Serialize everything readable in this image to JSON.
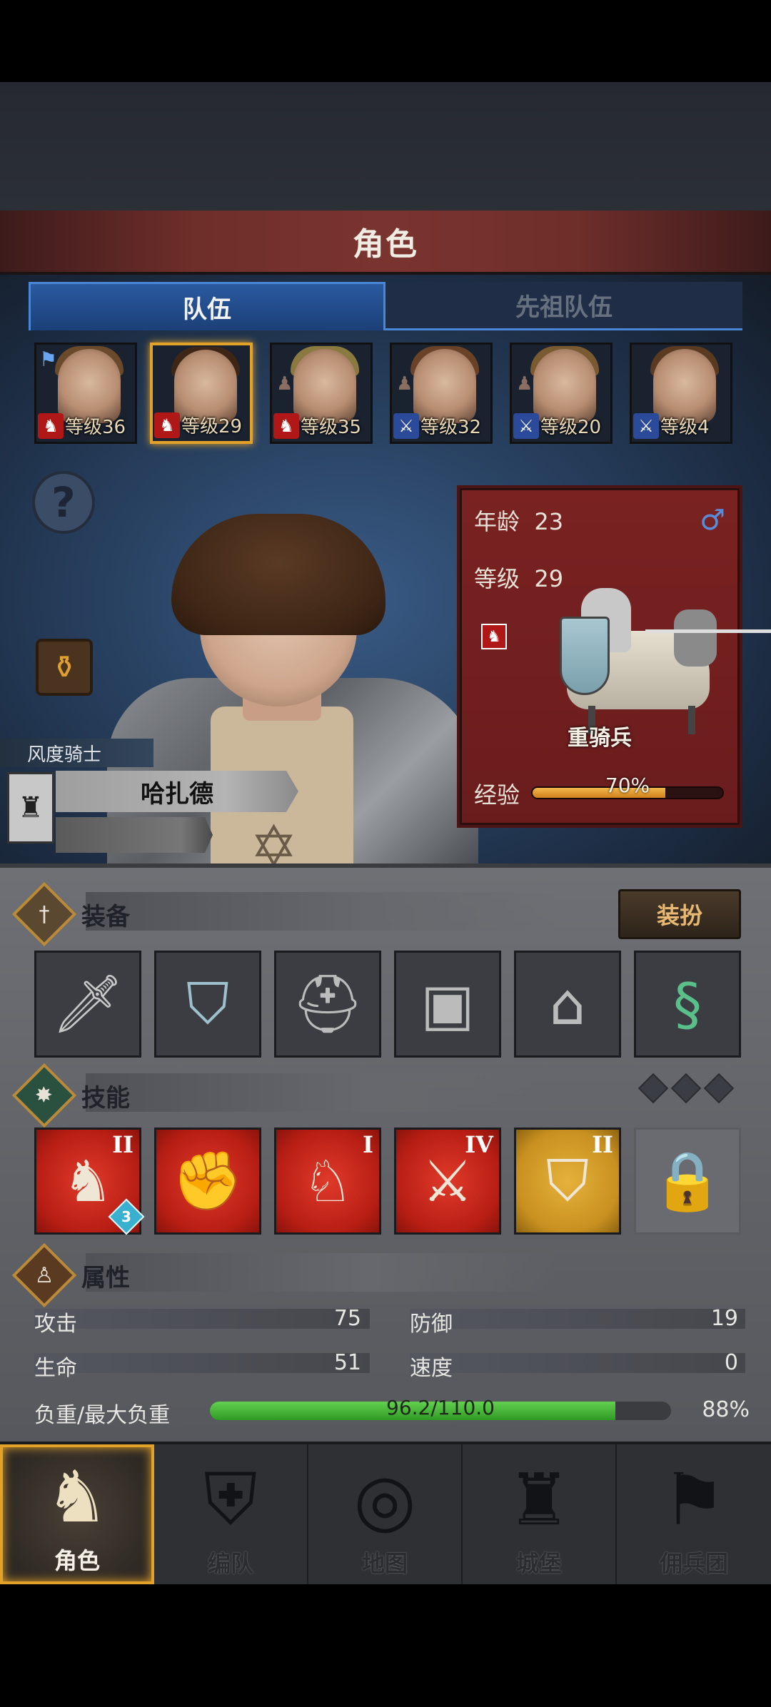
{
  "title": "角色",
  "tabs": [
    {
      "label": "队伍",
      "active": true
    },
    {
      "label": "先祖队伍",
      "active": false
    }
  ],
  "roster": [
    {
      "level_text": "等级36",
      "type": "cavalry",
      "flag": true
    },
    {
      "level_text": "等级29",
      "type": "cavalry",
      "selected": true
    },
    {
      "level_text": "等级35",
      "type": "cavalry"
    },
    {
      "level_text": "等级32",
      "type": "sword"
    },
    {
      "level_text": "等级20",
      "type": "sword"
    },
    {
      "level_text": "等级4",
      "type": "sword"
    }
  ],
  "hero": {
    "class_title": "风度骑士",
    "name": "哈扎德"
  },
  "info": {
    "age_label": "年龄",
    "age": "23",
    "level_label": "等级",
    "level": "29",
    "gender_symbol": "♂",
    "unit_name": "重骑兵",
    "exp_label": "经验",
    "exp_percent_text": "70%",
    "exp_fraction": 0.7
  },
  "sections": {
    "equipment": "装备",
    "skills": "技能",
    "attributes": "属性"
  },
  "dress_button": "装扮",
  "equipment_slots": [
    "spear",
    "shield",
    "helmet",
    "chest-armor",
    "boots",
    "jade-amulet"
  ],
  "skills": [
    {
      "icon": "cavalry-sword",
      "rank": "II",
      "badge": "3",
      "color": "red"
    },
    {
      "icon": "dumbbell-hand",
      "rank": "",
      "color": "red"
    },
    {
      "icon": "dumbbell-horse",
      "rank": "I",
      "color": "red"
    },
    {
      "icon": "sword",
      "rank": "IV",
      "color": "red"
    },
    {
      "icon": "shield-rune",
      "rank": "II",
      "color": "gold"
    },
    {
      "icon": "padlock",
      "rank": "",
      "color": "locked"
    }
  ],
  "stats": {
    "attack_label": "攻击",
    "attack": "75",
    "defense_label": "防御",
    "defense": "19",
    "hp_label": "生命",
    "hp": "51",
    "speed_label": "速度",
    "speed": "0",
    "load_label": "负重/最大负重",
    "load_text": "96.2/110.0",
    "load_percent": "88%",
    "load_fraction": 0.88
  },
  "nav": [
    {
      "label": "角色",
      "icon": "knight-icon",
      "active": true
    },
    {
      "label": "编队",
      "icon": "formation-icon"
    },
    {
      "label": "地图",
      "icon": "compass-map-icon"
    },
    {
      "label": "城堡",
      "icon": "castle-icon"
    },
    {
      "label": "佣兵团",
      "icon": "mercenary-icon"
    }
  ],
  "colors": {
    "accent_gold": "#e2a22a",
    "tab_blue": "#2a5aa0",
    "cavalry_red": "#b01818",
    "sword_blue": "#2c4a9a"
  }
}
